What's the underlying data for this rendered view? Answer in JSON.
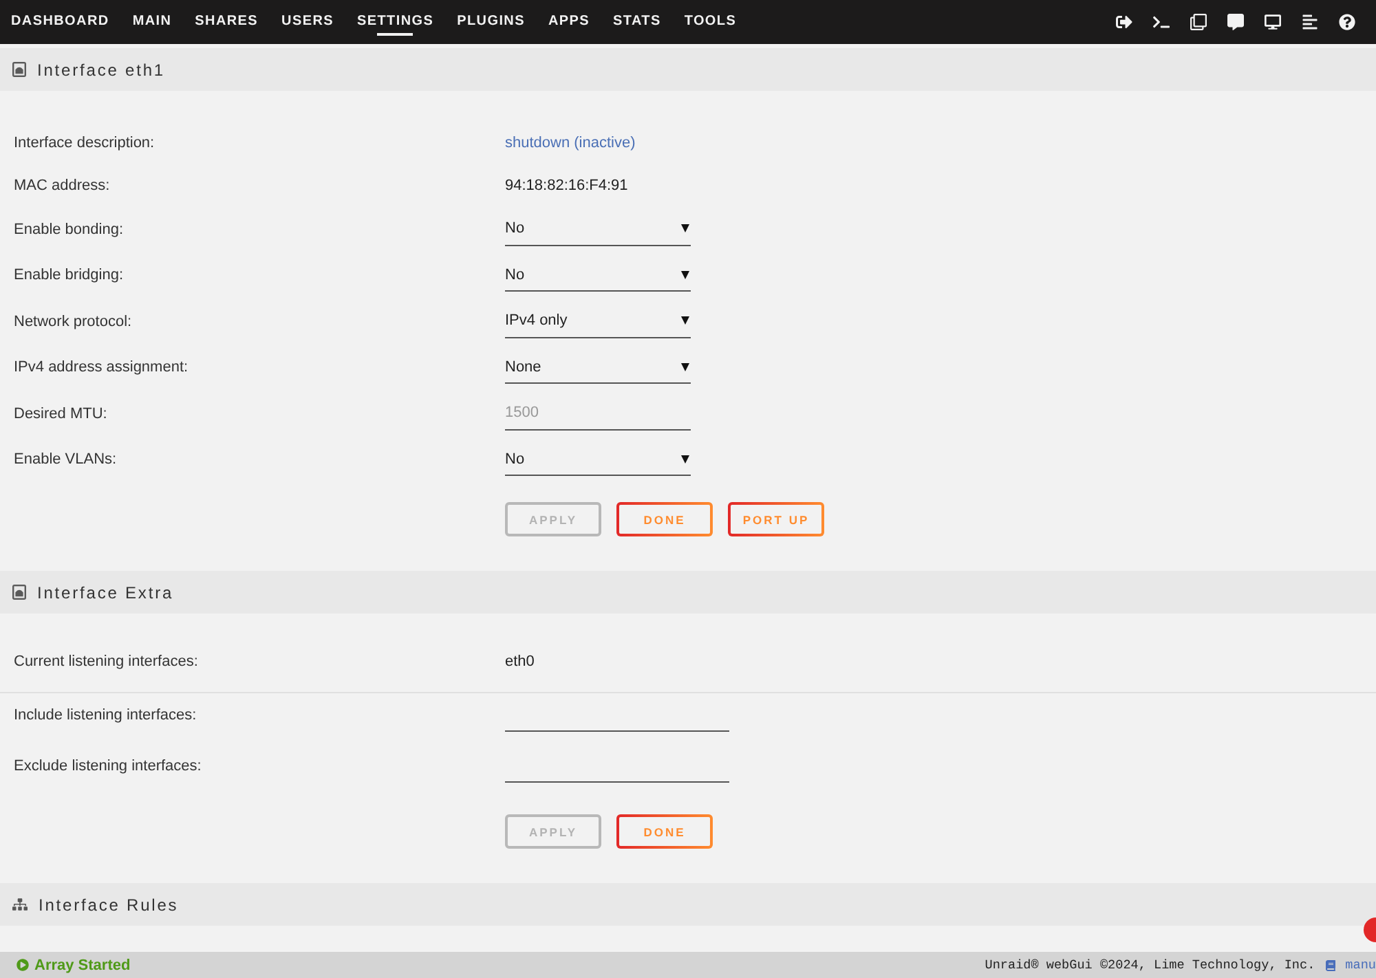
{
  "nav": {
    "tabs": [
      {
        "label": "DASHBOARD",
        "selected": false
      },
      {
        "label": "MAIN",
        "selected": false
      },
      {
        "label": "SHARES",
        "selected": false
      },
      {
        "label": "USERS",
        "selected": false
      },
      {
        "label": "SETTINGS",
        "selected": true
      },
      {
        "label": "PLUGINS",
        "selected": false
      },
      {
        "label": "APPS",
        "selected": false
      },
      {
        "label": "STATS",
        "selected": false
      },
      {
        "label": "TOOLS",
        "selected": false
      }
    ]
  },
  "sections": [
    {
      "title": "Interface eth1",
      "rows": [
        {
          "kind": "link",
          "label": "Interface description:",
          "value": "shutdown (inactive)"
        },
        {
          "kind": "text",
          "label": "MAC address:",
          "value": "94:18:82:16:F4:91"
        },
        {
          "kind": "select",
          "label": "Enable bonding:",
          "value": "No"
        },
        {
          "kind": "select",
          "label": "Enable bridging:",
          "value": "No"
        },
        {
          "kind": "select",
          "label": "Network protocol:",
          "value": "IPv4 only"
        },
        {
          "kind": "select",
          "label": "IPv4 address assignment:",
          "value": "None"
        },
        {
          "kind": "number",
          "label": "Desired MTU:",
          "placeholder": "1500"
        },
        {
          "kind": "select",
          "label": "Enable VLANs:",
          "value": "No"
        }
      ],
      "buttons": [
        {
          "label": "APPLY",
          "disabled": true
        },
        {
          "label": "DONE",
          "disabled": false
        },
        {
          "label": "PORT UP",
          "disabled": false
        }
      ]
    },
    {
      "title": "Interface Extra",
      "rows": [
        {
          "kind": "text",
          "label": "Current listening interfaces:",
          "value": "eth0",
          "divider": true
        },
        {
          "kind": "input",
          "label": "Include listening interfaces:"
        },
        {
          "kind": "input",
          "label": "Exclude listening interfaces:"
        }
      ],
      "buttons": [
        {
          "label": "APPLY",
          "disabled": true
        },
        {
          "label": "DONE",
          "disabled": false
        }
      ]
    },
    {
      "title": "Interface Rules"
    }
  ],
  "footer": {
    "status": "Array Started",
    "copyright": "Unraid® webGui ©2024, Lime Technology, Inc.",
    "manual_link": "manu"
  }
}
